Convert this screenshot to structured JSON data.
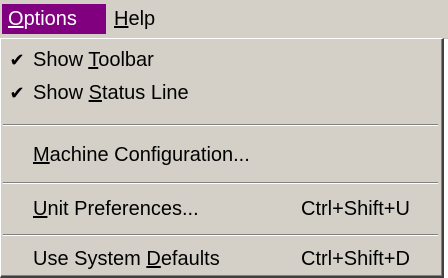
{
  "menubar": {
    "options": {
      "accel": "O",
      "rest": "ptions"
    },
    "help": {
      "accel": "H",
      "rest": "elp"
    }
  },
  "menu": {
    "show_toolbar": {
      "pre": "Show ",
      "accel": "T",
      "post": "oolbar",
      "checked": "✔"
    },
    "show_status": {
      "pre": "Show ",
      "accel": "S",
      "post": "tatus Line",
      "checked": "✔"
    },
    "machine_config": {
      "pre": "",
      "accel": "M",
      "post": "achine Configuration..."
    },
    "unit_prefs": {
      "pre": "",
      "accel": "U",
      "post": "nit Preferences...",
      "shortcut": "Ctrl+Shift+U"
    },
    "use_defaults": {
      "pre": "Use System ",
      "accel": "D",
      "post": "efaults",
      "shortcut": "Ctrl+Shift+D"
    }
  },
  "colors": {
    "highlight": "#800080",
    "face": "#d4d0c8"
  }
}
